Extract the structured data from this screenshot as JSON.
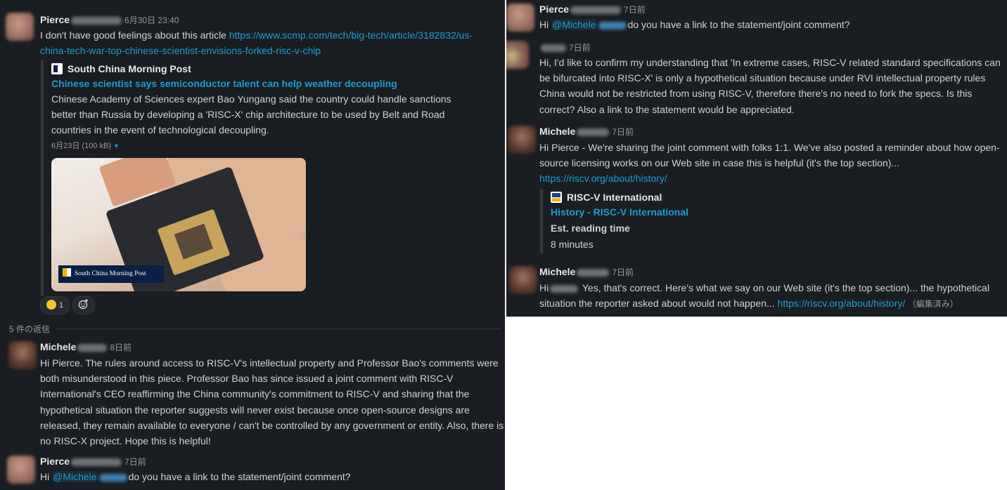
{
  "left": {
    "msg1": {
      "name": "Pierce",
      "time": "6月30日 23:40",
      "text_line1": "I don't have good feelings about this article ",
      "link_part1": "https://www.scmp.com/tech/big-tech/article/3182832/us-",
      "link_part2": "china-tech-war-top-chinese-scientist-envisions-forked-risc-v-chip",
      "unfurl": {
        "site": "South China Morning Post",
        "title": "Chinese scientist says semiconductor talent can help weather decoupling",
        "desc1": "Chinese Academy of Sciences expert Bao Yungang said the country could handle sanctions",
        "desc2": "better than Russia by developing a 'RISC-X' chip architecture to be used by Belt and Road",
        "desc3": "countries in the event of technological decoupling.",
        "meta": "6月23日 (100 kB)",
        "caret": "▼",
        "image_brand": "South China Morning Post"
      },
      "reaction_count": "1"
    },
    "replies_label": "5 件の返信",
    "msg2": {
      "name": "Michele",
      "time": "8日前",
      "lines": [
        "Hi Pierce. The rules around access to RISC-V's intellectual property and Professor Bao's comments were",
        "both misunderstood in this piece. Professor Bao has since issued a joint comment with RISC-V",
        "International's CEO reaffirming the China community's commitment to RISC-V and sharing that the",
        "hypothetical situation the reporter suggests will never exist because once open-source designs are",
        "released, they remain available to everyone / can't be controlled by any government or entity. Also, there is",
        "no RISC-X project. Hope this is helpful!"
      ]
    },
    "msg3": {
      "name": "Pierce",
      "time": "7日前",
      "hi": "Hi ",
      "mention": "@Michele",
      "rest": "do you have a link to the statement/joint comment?"
    }
  },
  "right": {
    "msg1": {
      "name": "Pierce",
      "time": "7日前",
      "hi": "Hi ",
      "mention": "@Michele",
      "rest": "do you have a link to the statement/joint comment?"
    },
    "msg2": {
      "time": "7日前",
      "lines": [
        "Hi, I'd like to confirm my understanding that 'In extreme cases, RISC-V related standard specifications can",
        "be bifurcated into RISC-X' is only a hypothetical situation because under RVI intellectual property rules",
        "China would not be restricted from using RISC-V, therefore there's no need to fork the specs. Is this",
        "correct? Also a link to the statement would be appreciated."
      ]
    },
    "msg3": {
      "name": "Michele",
      "time": "7日前",
      "line1": "Hi Pierce - We're sharing the joint comment with folks 1:1. We've also posted a reminder about how open-",
      "line2": "source licensing works on our Web site in case this is helpful (it's the top section)...",
      "link": "https://riscv.org/about/history/",
      "unfurl": {
        "site": "RISC-V International",
        "title": "History - RISC-V International",
        "field_label": "Est. reading time",
        "field_value": "8 minutes"
      }
    },
    "msg4": {
      "name": "Michele",
      "time": "7日前",
      "hi": "Hi",
      "line1_rest": " Yes, that's correct. Here's what we say on our Web site (it's the top section)... the hypothetical",
      "line2": "situation the reporter asked about would not happen... ",
      "link": "https://riscv.org/about/history/",
      "edited": " （編集済み）"
    }
  }
}
